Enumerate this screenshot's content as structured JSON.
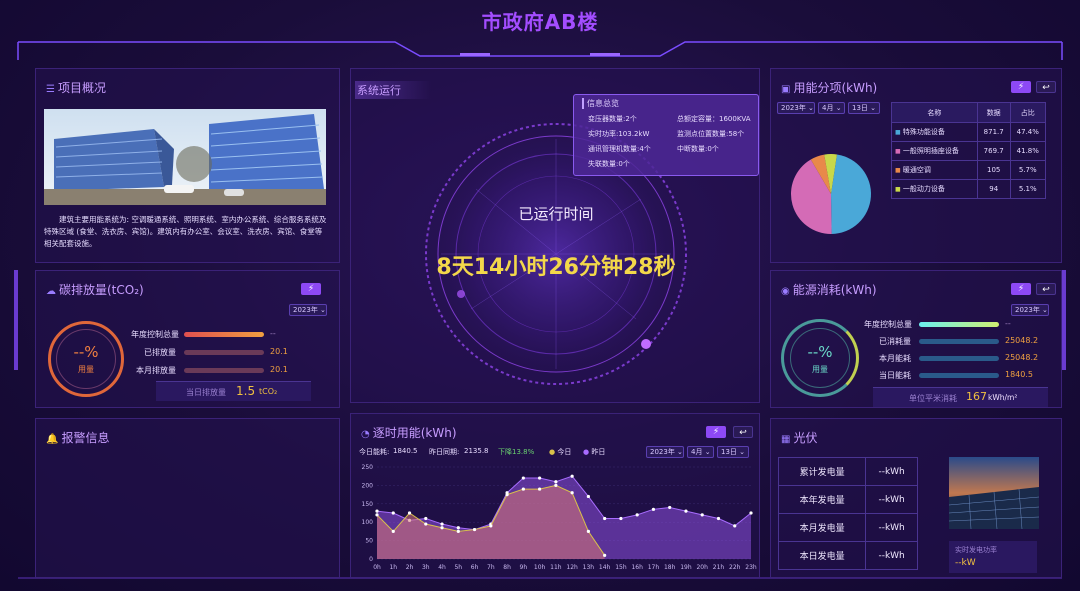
{
  "header": {
    "title": "市政府AB楼"
  },
  "project": {
    "title": "项目概况",
    "icon": "list-icon",
    "description": "建筑主要用能系统为: 空调暖通系统、照明系统、室内办公系统、综合服务系统及特殊区域 (食堂、洗衣房、宾馆)。建筑内有办公室、会议室、洗衣房、宾馆、食堂等相关配套设施。"
  },
  "system": {
    "title": "系统运行",
    "runtime_label": "已运行时间",
    "runtime_value": "8天14小时26分钟28秒",
    "info": {
      "title": "信息总览",
      "rows": [
        [
          "变压器数量:2个",
          "总额定容量：1600KVA"
        ],
        [
          "实时功率:103.2kW",
          "监测点位置数量:58个"
        ],
        [
          "通讯管理机数量:4个",
          "中断数量:0个"
        ],
        [
          "失联数量:0个",
          ""
        ]
      ]
    }
  },
  "energy_items": {
    "title": "用能分项(kWh)",
    "year": "2023年",
    "month": "4月",
    "day": "13日",
    "table_headers": [
      "名称",
      "数据",
      "占比"
    ],
    "rows": [
      {
        "name": "特殊功能设备",
        "value": "871.7",
        "pct": "47.4%",
        "color": "#4aa8d8"
      },
      {
        "name": "一般照明插座设备",
        "value": "769.7",
        "pct": "41.8%",
        "color": "#d46bb6"
      },
      {
        "name": "暖通空调",
        "value": "105",
        "pct": "5.7%",
        "color": "#e8894a"
      },
      {
        "name": "一般动力设备",
        "value": "94",
        "pct": "5.1%",
        "color": "#c8d84a"
      }
    ]
  },
  "carbon": {
    "title": "碳排放量(tCO₂)",
    "year": "2023年",
    "gauge_value": "--%",
    "gauge_label": "用量",
    "rows": [
      {
        "label": "年度控制总量",
        "value": "--",
        "fill": 1.0,
        "color": "#e87a3a"
      },
      {
        "label": "已排放量",
        "value": "20.1",
        "fill": 1.0,
        "color": "#6a3a5a"
      },
      {
        "label": "本月排放量",
        "value": "20.1",
        "fill": 1.0,
        "color": "#6a3a5a"
      }
    ],
    "today_label": "当日排放量",
    "today_value": "1.5",
    "today_unit": "tCO₂"
  },
  "energy_consumption": {
    "title": "能源消耗(kWh)",
    "year": "2023年",
    "gauge_value": "--%",
    "gauge_label": "用量",
    "rows": [
      {
        "label": "年度控制总量",
        "value": "--",
        "fill": 1.0,
        "color": "#7af0d0"
      },
      {
        "label": "已消耗量",
        "value": "25048.2",
        "fill": 1.0,
        "color": "#2a5a8a"
      },
      {
        "label": "本月能耗",
        "value": "25048.2",
        "fill": 1.0,
        "color": "#2a5a8a"
      },
      {
        "label": "当日能耗",
        "value": "1840.5",
        "fill": 1.0,
        "color": "#2a5a8a"
      }
    ],
    "unit_label": "单位平米消耗",
    "unit_value": "167",
    "unit_unit": "kWh/m²"
  },
  "alarm": {
    "title": "报警信息"
  },
  "hourly": {
    "title": "逐时用能(kWh)",
    "today_label": "今日能耗:",
    "today_value": "1840.5",
    "yesterday_label": "昨日同期:",
    "yesterday_value": "2135.8",
    "trend": "下降13.8%",
    "legend_today": "今日",
    "legend_yesterday": "昨日",
    "year": "2023年",
    "month": "4月",
    "day": "13日"
  },
  "pv": {
    "title": "光伏",
    "rows": [
      {
        "label": "累计发电量",
        "value": "--kWh"
      },
      {
        "label": "本年发电量",
        "value": "--kWh"
      },
      {
        "label": "本月发电量",
        "value": "--kWh"
      },
      {
        "label": "本日发电量",
        "value": "--kWh"
      }
    ],
    "realtime_label": "实时发电功率",
    "realtime_value": "--kW"
  },
  "chart_data": {
    "type": "area",
    "x": [
      "0h",
      "1h",
      "2h",
      "3h",
      "4h",
      "5h",
      "6h",
      "7h",
      "8h",
      "9h",
      "10h",
      "11h",
      "12h",
      "13h",
      "14h",
      "15h",
      "16h",
      "17h",
      "18h",
      "19h",
      "20h",
      "21h",
      "22h",
      "23h"
    ],
    "ylim": [
      0,
      250
    ],
    "yticks": [
      0,
      50,
      100,
      150,
      200,
      250
    ],
    "series": [
      {
        "name": "今日",
        "color": "#d9c24a",
        "values": [
          120,
          75,
          125,
          95,
          85,
          75,
          80,
          90,
          175,
          190,
          190,
          200,
          180,
          75,
          10
        ]
      },
      {
        "name": "昨日",
        "color": "#a86cff",
        "values": [
          130,
          125,
          105,
          110,
          95,
          85,
          80,
          95,
          180,
          220,
          220,
          210,
          225,
          170,
          110,
          110,
          120,
          135,
          140,
          130,
          120,
          110,
          90,
          125
        ]
      }
    ]
  }
}
